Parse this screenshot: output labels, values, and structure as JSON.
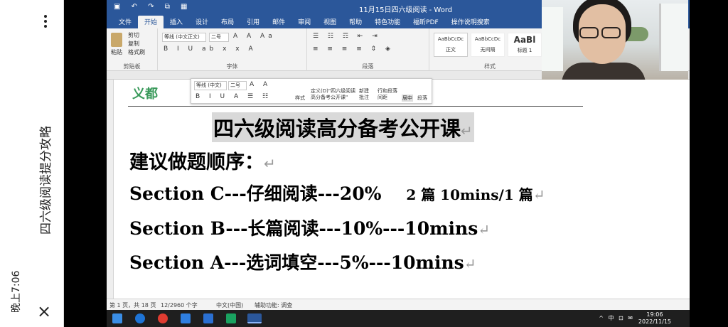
{
  "phone": {
    "status": "晚上7:06",
    "title": "四六级阅读提分攻略",
    "close_glyph": "×"
  },
  "word": {
    "doc_title": "11月15日四六级阅读 - Word",
    "tabs": [
      "文件",
      "开始",
      "插入",
      "设计",
      "布局",
      "引用",
      "邮件",
      "审阅",
      "视图",
      "帮助",
      "特色功能",
      "福昕PDF",
      "操作说明搜索"
    ],
    "active_tab": "开始",
    "groups": {
      "clipboard": {
        "name": "剪贴板",
        "paste": "粘贴",
        "cut": "剪切",
        "copy": "复制",
        "format_painter": "格式刷"
      },
      "font": {
        "name": "字体",
        "font_name": "等线 (中文正文)",
        "font_size": "二号"
      },
      "paragraph": {
        "name": "段落"
      },
      "styles": {
        "name": "样式",
        "items": [
          "正文",
          "无间隔",
          "标题 1"
        ],
        "previews": [
          "AaBbCcDc",
          "AaBbCcDc",
          "AaBl"
        ]
      }
    },
    "mini_toolbar": {
      "font_name": "等线 (中文)",
      "font_size": "二号",
      "styles": "样式",
      "define": "定义(D)\"四六级阅读高分备考公开课\"",
      "new_comment": "新建批注",
      "line_spacing": "行和段落间距",
      "center": "居中",
      "paragraph": "段落"
    },
    "logo_text": "义都",
    "content": {
      "title": "四六级阅读高分备考公开课",
      "line1": "建议做题顺序：",
      "line2_main": "Section C---仔细阅读---20%",
      "line2_tail": "2 篇  10mins/1 篇",
      "line3": "Section B---长篇阅读---10%---10mins",
      "line4": "Section A---选词填空---5%---10mins",
      "para_mark": "↵"
    },
    "status": {
      "page": "第 1 页，共 18 页",
      "words": "12/2960 个字",
      "lang": "中文(中国)",
      "accessibility": "辅助功能: 调查"
    }
  },
  "taskbar": {
    "time": "19:06",
    "date": "2022/11/15",
    "ime": "中",
    "tray": "^ 中 ⊡ ✉"
  },
  "colors": {
    "word_blue": "#2b579a",
    "highlight": "#d9d9d9",
    "taskbar": "#1f1f1f"
  }
}
